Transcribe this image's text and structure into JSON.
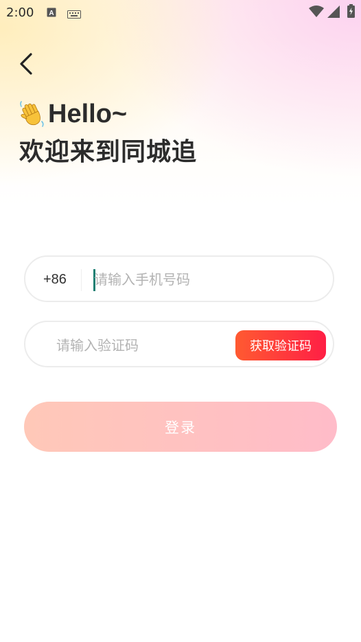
{
  "status_bar": {
    "time": "2:00",
    "icons": [
      "text-a-icon",
      "keyboard-icon",
      "wifi-icon",
      "signal-icon",
      "battery-icon"
    ]
  },
  "nav": {
    "back_icon": "chevron-left-icon"
  },
  "header": {
    "greeting_emoji": "waving-hand-icon",
    "greeting": "Hello~",
    "welcome": "欢迎来到同城追"
  },
  "form": {
    "country_code": "+86",
    "phone_placeholder": "请输入手机号码",
    "phone_value": "",
    "code_placeholder": "请输入验证码",
    "code_value": "",
    "get_code_label": "获取验证码",
    "login_label": "登录"
  },
  "colors": {
    "primary_gradient_start": "#ff5a31",
    "primary_gradient_end": "#ff1f45",
    "login_disabled_start": "#ffc8b8",
    "login_disabled_end": "#ffbcc9",
    "caret": "#1a7f72"
  }
}
